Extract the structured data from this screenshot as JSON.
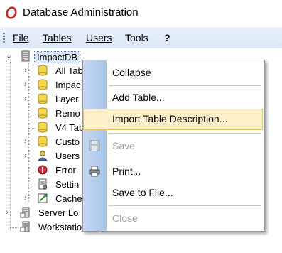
{
  "window": {
    "title": "Database Administration"
  },
  "menubar": {
    "items": [
      {
        "label": "File"
      },
      {
        "label": "Tables"
      },
      {
        "label": "Users"
      },
      {
        "label": "Tools"
      },
      {
        "label": "?"
      }
    ]
  },
  "tree": {
    "root": "ImpactDB",
    "children": [
      {
        "label": "All Tab"
      },
      {
        "label": "Impac"
      },
      {
        "label": "Layer"
      },
      {
        "label": "Remo"
      },
      {
        "label": "V4 Tab"
      },
      {
        "label": "Custo"
      },
      {
        "label": "Users"
      },
      {
        "label": "Error"
      },
      {
        "label": "Settin"
      },
      {
        "label": "Cache"
      }
    ],
    "siblings": [
      {
        "label": "Server Lo"
      },
      {
        "label": "Workstation Log"
      }
    ]
  },
  "context_menu": {
    "items": [
      {
        "label": "Collapse"
      },
      {
        "label": "Add Table..."
      },
      {
        "label": "Import Table Description..."
      },
      {
        "label": "Save"
      },
      {
        "label": "Print..."
      },
      {
        "label": "Save to File..."
      },
      {
        "label": "Close"
      }
    ]
  }
}
